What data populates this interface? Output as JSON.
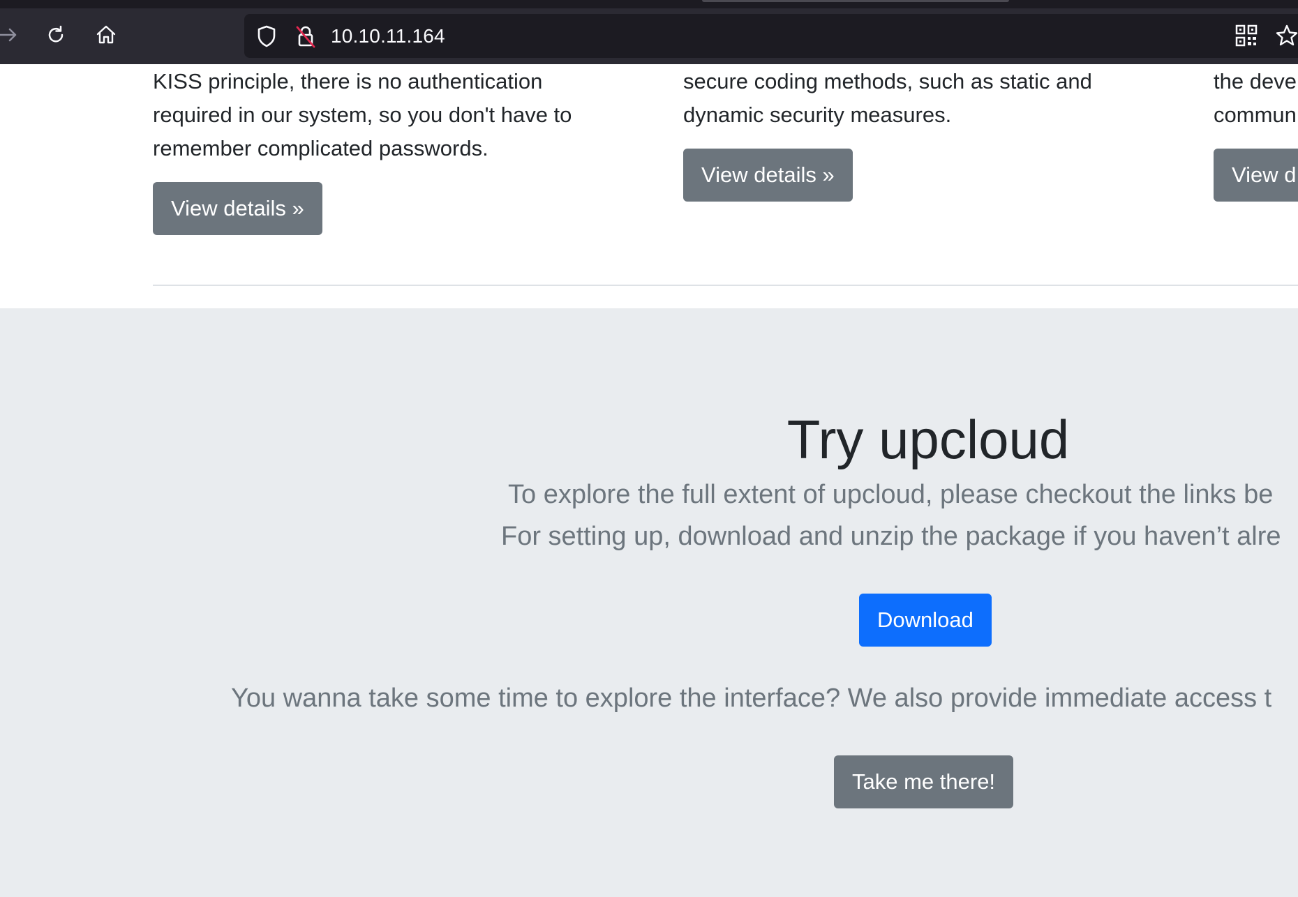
{
  "browser": {
    "url": "10.10.11.164",
    "icons": {
      "forward": "arrow-right-icon",
      "reload": "reload-icon",
      "home": "home-icon",
      "shield": "shield-icon",
      "insecure_lock": "lock-slash-icon",
      "qr": "qr-code-icon",
      "bookmark": "star-icon"
    }
  },
  "features": [
    {
      "text": "KISS principle, there is no authentication required in our system, so you don't have to remember complicated passwords.",
      "button": "View details »"
    },
    {
      "text": "secure coding methods, such as static and dynamic security measures.",
      "button": "View details »"
    },
    {
      "text": "the deve commun",
      "button": "View d"
    }
  ],
  "jumbotron": {
    "title": "Try upcloud",
    "lead1": "To explore the full extent of upcloud, please checkout the links be",
    "lead2": "For setting up, download and unzip the package if you haven’t alre",
    "download_label": "Download",
    "lead3": "You wanna take some time to explore the interface? We also provide immediate access t",
    "cta_label": "Take me there!"
  },
  "colors": {
    "chrome": "#2b2a33",
    "urlbar": "#1c1b22",
    "secondary": "#6c757d",
    "primary": "#0d6efd",
    "jumbotron_bg": "#e9ecef"
  }
}
